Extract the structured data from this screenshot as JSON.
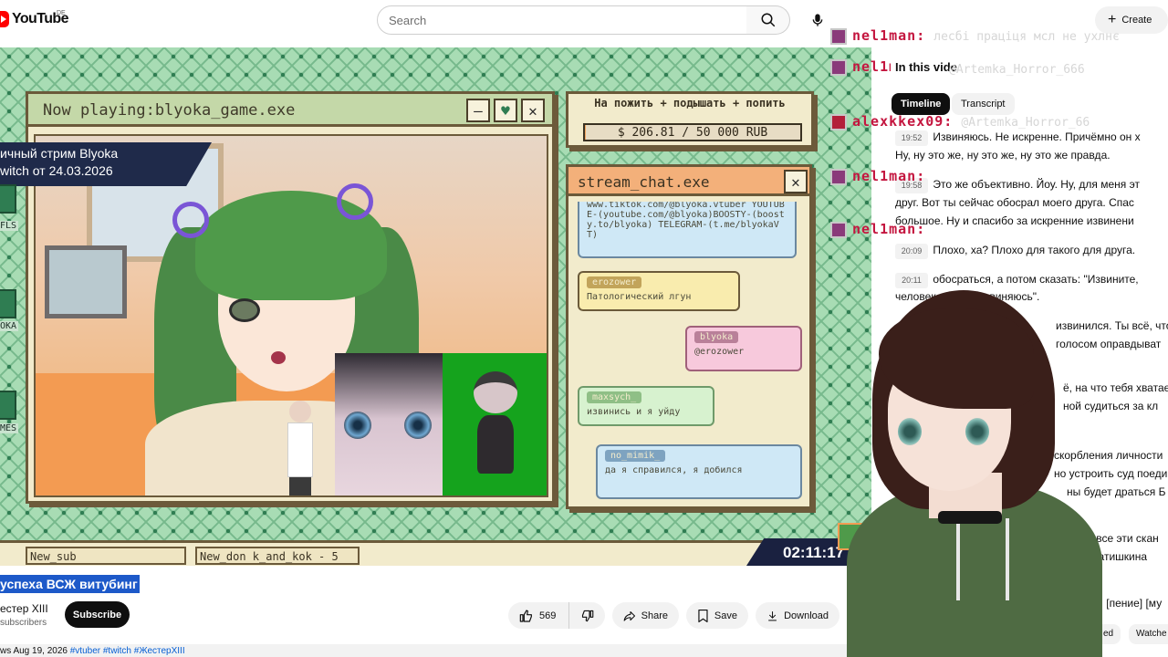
{
  "header": {
    "logo_text": "YouTube",
    "region": "DE",
    "search_placeholder": "Search",
    "create_label": "Create"
  },
  "video": {
    "game_window_title": "Now playing:blyoka_game.exe",
    "game_window_buttons": [
      "—",
      "♥",
      "✕"
    ],
    "stream_banner_line1": "ичный стрим Blyoka",
    "stream_banner_line2": "witch от 24.03.2026",
    "left_labels": [
      "FLS",
      "OKA",
      "MES"
    ],
    "donate": {
      "title": "На пожить + подышать + попить",
      "amount_text": "$ 206.81 / 50 000 RUB",
      "progress_fraction": 0.004
    },
    "chat_window_title": "stream_chat.exe",
    "chat_messages": [
      {
        "user": "",
        "text": "www.tiktok.com/@blyoka.vtuber YOUTUBE-(youtube.com/@blyoka)BOOSTY-(boosty.to/blyoka) TELEGRAM-(t.me/blyokaVT)"
      },
      {
        "user": "erozower",
        "text": "Патологический лгун"
      },
      {
        "user": "blyoka",
        "text": "@erozower"
      },
      {
        "user": "maxsych_",
        "text": "извинись и я уйду"
      },
      {
        "user": "no_mimik_",
        "text": "да я справился, я добился"
      }
    ],
    "bottom_field_1": "New_sub",
    "bottom_field_2": "New_don k_and_kok - 5",
    "time_display": "02:11:17"
  },
  "below_video": {
    "title": "успеха ВСЖ витубинг",
    "channel_name": "естер XIII",
    "channel_subs": "subscribers",
    "subscribe_label": "Subscribe",
    "like_count": "569",
    "share_label": "Share",
    "save_label": "Save",
    "download_label": "Download",
    "meta_prefix": "ws  Aug 19, 2026",
    "hashtags": "#vtuber #twitch #ЖестерXIII"
  },
  "transcript": {
    "panel_title": "In this vide",
    "tabs": [
      "Timeline",
      "Transcript"
    ],
    "segments": [
      {
        "ts": "19:52",
        "text": "Извиняюсь. Не искренне. Причёмно он х"
      },
      {
        "ts": "",
        "text": "Ну, ну это же, ну это же, ну это же правда."
      },
      {
        "ts": "19:58",
        "text": "Это же объективно. Йоу. Ну, для меня эт"
      },
      {
        "ts": "",
        "text": "друг. Вот ты сейчас обосрал моего друга. Спас"
      },
      {
        "ts": "",
        "text": "большое. Ну и спасибо за искренние извинени"
      },
      {
        "ts": "20:09",
        "text": "Плохо, ха? Плохо для такого для друга."
      },
      {
        "ts": "20:11",
        "text": "обосраться, а потом сказать: \"Извините,"
      },
      {
        "ts": "",
        "text": "человек, не оне извиняюсь\"."
      },
      {
        "ts": "",
        "text": "извинился. Ты всё, что"
      },
      {
        "ts": "",
        "text": "голосом оправдыват"
      },
      {
        "ts": "",
        "text": "ё, на что тебя хватае"
      },
      {
        "ts": "",
        "text": "ной судиться за кл"
      },
      {
        "ts": "",
        "text": "скорбления личности"
      },
      {
        "ts": "",
        "text": "но устроить суд поеди"
      },
      {
        "ts": "",
        "text": "ны будет драться Б"
      },
      {
        "ts": "",
        "text": ", что все эти скан"
      },
      {
        "ts": "",
        "text": "до братишкина"
      },
      {
        "ts": "",
        "text": "ы. [пение] [му"
      }
    ],
    "bottom_chips": [
      "ed",
      "Watche"
    ]
  },
  "overlay_chat": [
    {
      "user": "nel1man:",
      "msg": "лесбі праціця мсл не ухлнє"
    },
    {
      "user": "nel1man:",
      "msg": "@Artemka_Horror_666"
    },
    {
      "user": "alexkkex09:",
      "msg": "@Artemka_Horror_66"
    },
    {
      "user": "nel1man:",
      "msg": ""
    },
    {
      "user": "nel1man:",
      "msg": ""
    }
  ],
  "colors": {
    "video_bg": "#a8dcb4",
    "window_bg": "#f2ebcc",
    "chat_title_bg": "#f3b07a",
    "overlay_name": "#c4163f",
    "accent": "#065fd4"
  }
}
